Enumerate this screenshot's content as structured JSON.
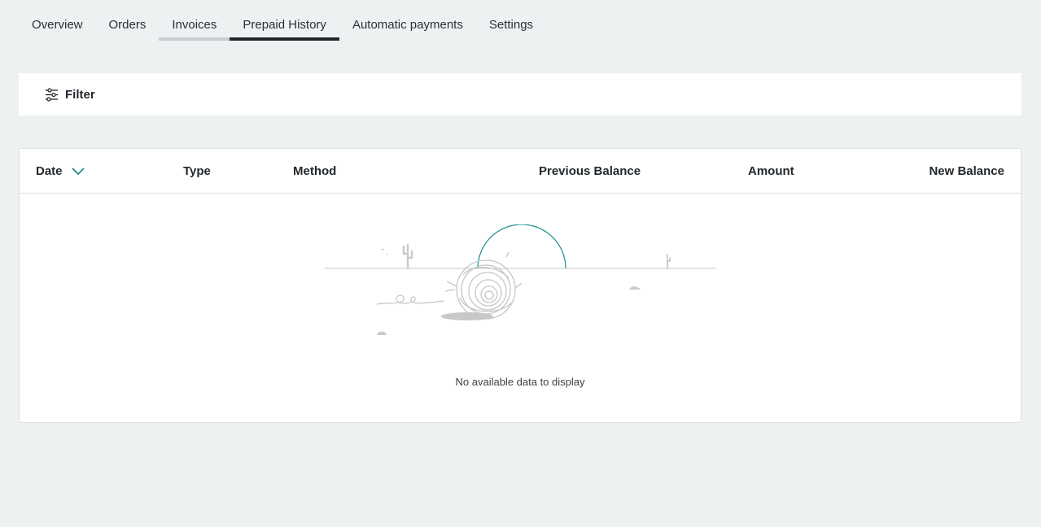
{
  "tabs": [
    {
      "label": "Overview"
    },
    {
      "label": "Orders"
    },
    {
      "label": "Invoices"
    },
    {
      "label": "Prepaid History"
    },
    {
      "label": "Automatic payments"
    },
    {
      "label": "Settings"
    }
  ],
  "active_tab": "Prepaid History",
  "filter": {
    "label": "Filter",
    "icon": "sliders-icon"
  },
  "table": {
    "columns": [
      "Date",
      "Type",
      "Method",
      "Previous Balance",
      "Amount",
      "New Balance"
    ],
    "sort_column": "Date",
    "sort_direction": "descending",
    "empty_message": "No available data to display"
  },
  "colors": {
    "accent": "#1a8f8f",
    "background": "#eef1f2",
    "active_tab_bar": "#22272b"
  }
}
